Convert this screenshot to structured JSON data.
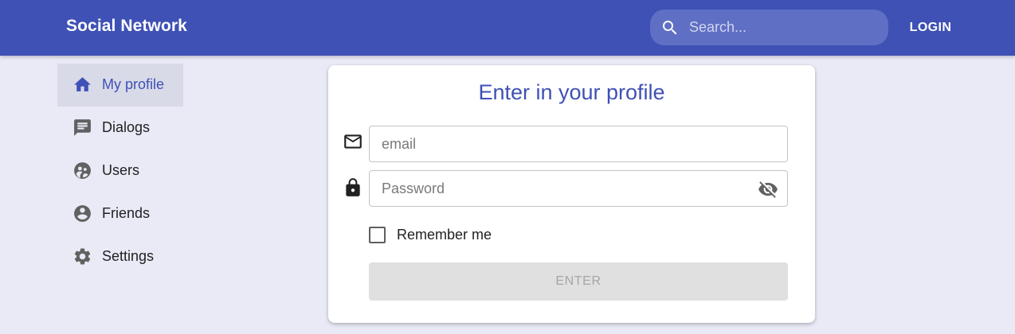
{
  "app": {
    "title": "Social Network",
    "colors": {
      "primary": "#3f51b5",
      "background": "#e9eaf6",
      "search_bg": "#5f6fc4"
    }
  },
  "header": {
    "search": {
      "placeholder": "Search...",
      "value": "",
      "icon": "search-icon"
    },
    "login_label": "LOGIN"
  },
  "sidebar": {
    "items": [
      {
        "label": "My profile",
        "icon": "home-icon",
        "active": true
      },
      {
        "label": "Dialogs",
        "icon": "chat-icon",
        "active": false
      },
      {
        "label": "Users",
        "icon": "users-icon",
        "active": false
      },
      {
        "label": "Friends",
        "icon": "account-circle-icon",
        "active": false
      },
      {
        "label": "Settings",
        "icon": "gear-icon",
        "active": false
      }
    ]
  },
  "login_form": {
    "title": "Enter in your profile",
    "email": {
      "placeholder": "email",
      "value": "",
      "icon": "mail-icon"
    },
    "password": {
      "placeholder": "Password",
      "value": "",
      "icon": "lock-icon",
      "toggle_icon": "eye-off-icon"
    },
    "remember_label": "Remember me",
    "remember_checked": false,
    "submit_label": "ENTER",
    "submit_disabled": true
  }
}
